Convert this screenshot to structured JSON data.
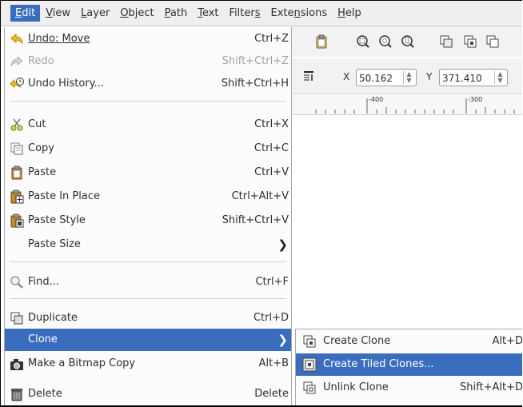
{
  "menubar": {
    "items": [
      "Edit",
      "View",
      "Layer",
      "Object",
      "Path",
      "Text",
      "Filters",
      "Extensions",
      "Help"
    ],
    "active": "Edit"
  },
  "edit_menu": {
    "undo": {
      "label": "Undo: Move",
      "shortcut": "Ctrl+Z"
    },
    "redo": {
      "label": "Redo",
      "shortcut": "Shift+Ctrl+Z"
    },
    "undo_history": {
      "label": "Undo History...",
      "shortcut": "Shift+Ctrl+H"
    },
    "cut": {
      "label": "Cut",
      "shortcut": "Ctrl+X"
    },
    "copy": {
      "label": "Copy",
      "shortcut": "Ctrl+C"
    },
    "paste": {
      "label": "Paste",
      "shortcut": "Ctrl+V"
    },
    "paste_in_place": {
      "label": "Paste In Place",
      "shortcut": "Ctrl+Alt+V"
    },
    "paste_style": {
      "label": "Paste Style",
      "shortcut": "Shift+Ctrl+V"
    },
    "paste_size": {
      "label": "Paste Size"
    },
    "find": {
      "label": "Find...",
      "shortcut": "Ctrl+F"
    },
    "duplicate": {
      "label": "Duplicate",
      "shortcut": "Ctrl+D"
    },
    "clone": {
      "label": "Clone"
    },
    "make_bitmap": {
      "label": "Make a Bitmap Copy",
      "shortcut": "Alt+B"
    },
    "delete": {
      "label": "Delete",
      "shortcut": "Delete"
    }
  },
  "clone_submenu": {
    "create_clone": {
      "label": "Create Clone",
      "shortcut": "Alt+D"
    },
    "create_tiled_clones": {
      "label": "Create Tiled Clones..."
    },
    "unlink_clone": {
      "label": "Unlink Clone",
      "shortcut": "Shift+Alt+D"
    }
  },
  "toolbar": {
    "x_label": "X",
    "x_value": "50.162",
    "y_label": "Y",
    "y_value": "371.410"
  },
  "ruler": {
    "labels": [
      "-400",
      "-300"
    ]
  },
  "colors": {
    "highlight": "#3b6dbf",
    "menubar_bg": "#efefef",
    "menu_bg": "#fcfcfc"
  }
}
